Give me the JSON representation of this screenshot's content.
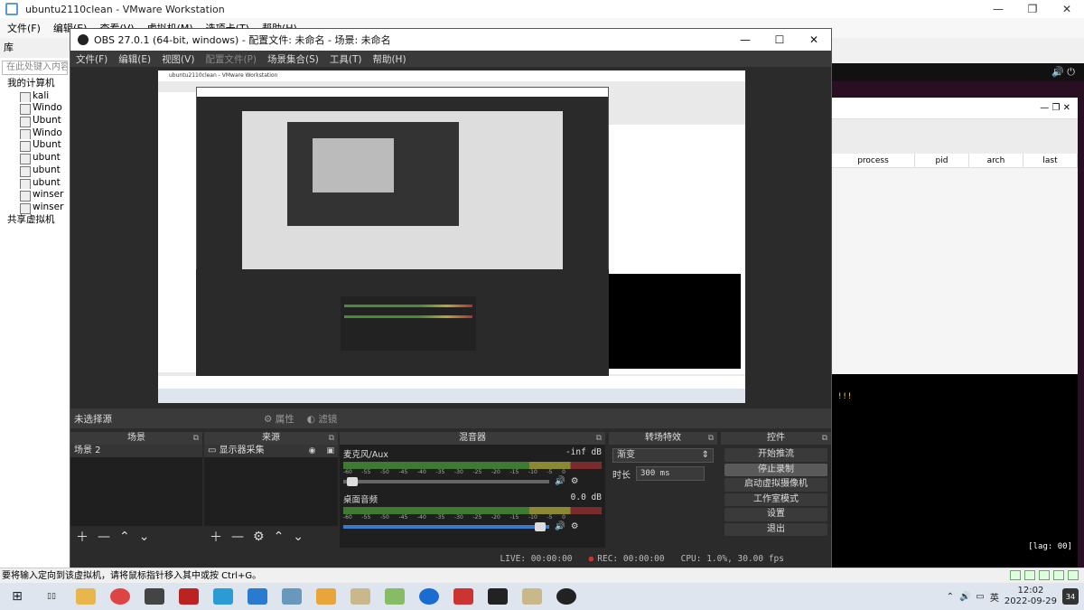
{
  "vmware": {
    "title": "ubuntu2110clean - VMware Workstation",
    "menu": [
      "文件(F)",
      "编辑(E)",
      "查看(V)",
      "虚拟机(M)",
      "选项卡(T)",
      "帮助(H)"
    ],
    "library_label": "库",
    "search_placeholder": "在此处键入内容进行搜索",
    "tree_root": "我的计算机",
    "tree_items": [
      "kali",
      "Windo",
      "Ubunt",
      "Windo",
      "Ubunt",
      "ubunt",
      "ubunt",
      "ubunt",
      "winser",
      "winser"
    ],
    "shared": "共享虚拟机",
    "status_text": "要将输入定向到该虚拟机，请将鼠标指针移入其中或按 Ctrl+G。"
  },
  "guest": {
    "process_headers": [
      "process",
      "pid",
      "arch",
      "last"
    ],
    "terminal_marks": "!!!",
    "lag": "[lag: 00]"
  },
  "obs": {
    "title": "OBS 27.0.1 (64-bit, windows) - 配置文件: 未命名 - 场景: 未命名",
    "menu": [
      "文件(F)",
      "编辑(E)",
      "视图(V)",
      "配置文件(P)",
      "场景集合(S)",
      "工具(T)",
      "帮助(H)"
    ],
    "no_source": "未选择源",
    "properties": "属性",
    "filters": "滤镜",
    "scenes": {
      "title": "场景",
      "items": [
        "场景 2"
      ]
    },
    "sources": {
      "title": "来源",
      "items": [
        "显示器采集"
      ]
    },
    "mixer": {
      "title": "混音器",
      "channels": [
        {
          "name": "麦克风/Aux",
          "level": "-inf dB",
          "fader": 0.02
        },
        {
          "name": "桌面音频",
          "level": "0.0 dB",
          "fader": 0.98
        }
      ],
      "ticks": [
        "-60",
        "-55",
        "-50",
        "-45",
        "-40",
        "-35",
        "-30",
        "-25",
        "-20",
        "-15",
        "-10",
        "-5",
        "0"
      ]
    },
    "transitions": {
      "title": "转场特效",
      "selected": "渐变",
      "duration_label": "时长",
      "duration": "300 ms"
    },
    "controls": {
      "title": "控件",
      "buttons": [
        "开始推流",
        "停止录制",
        "启动虚拟摄像机",
        "工作室模式",
        "设置",
        "退出"
      ]
    },
    "status": {
      "live": "LIVE: 00:00:00",
      "rec": "REC: 00:00:00",
      "cpu": "CPU: 1.0%, 30.00 fps"
    }
  },
  "taskbar": {
    "ime": "英",
    "time": "12:02",
    "date": "2022-09-29",
    "notifications": "34"
  }
}
